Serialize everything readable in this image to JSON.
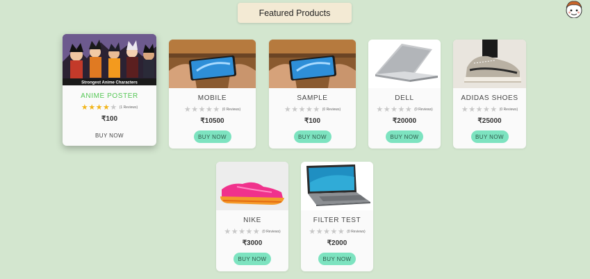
{
  "header": {
    "title": "Featured Products"
  },
  "colors": {
    "background": "#d3e6cf",
    "heading_bg": "#f3ead4",
    "button": "#7de3c0",
    "star_on": "#f2b51a",
    "star_off": "#c8c8c8",
    "hover_title": "#56c756"
  },
  "products": [
    {
      "name": "ANIME POSTER",
      "rating": 4,
      "reviews": "(1 Reviews)",
      "price": "₹100",
      "buy_label": "BUY NOW",
      "image": "anime-poster-image",
      "image_caption": "Strongest Anime Characters"
    },
    {
      "name": "MOBILE",
      "rating": 0,
      "reviews": "(0 Reviews)",
      "price": "₹10500",
      "buy_label": "BUY NOW",
      "image": "phone-in-hands-image"
    },
    {
      "name": "SAMPLE",
      "rating": 0,
      "reviews": "(0 Reviews)",
      "price": "₹100",
      "buy_label": "BUY NOW",
      "image": "phone-in-hands-image"
    },
    {
      "name": "DELL",
      "rating": 0,
      "reviews": "(0 Reviews)",
      "price": "₹20000",
      "buy_label": "BUY NOW",
      "image": "laptop-image"
    },
    {
      "name": "ADIDAS SHOES",
      "rating": 0,
      "reviews": "(0 Reviews)",
      "price": "₹25000",
      "buy_label": "BUY NOW",
      "image": "sneaker-image"
    },
    {
      "name": "NIKE",
      "rating": 0,
      "reviews": "(0 Reviews)",
      "price": "₹3000",
      "buy_label": "BUY NOW",
      "image": "running-shoe-image"
    },
    {
      "name": "FILTER TEST",
      "rating": 0,
      "reviews": "(0 Reviews)",
      "price": "₹2000",
      "buy_label": "BUY NOW",
      "image": "laptop-open-image"
    }
  ]
}
